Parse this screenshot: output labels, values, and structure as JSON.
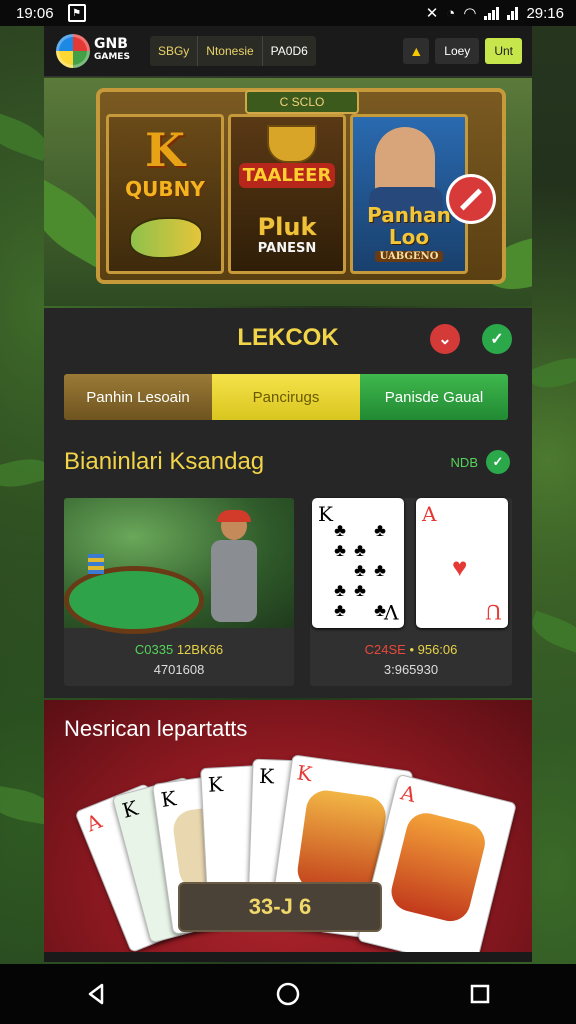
{
  "status": {
    "time": "19:06",
    "clock": "29:16"
  },
  "header": {
    "logo_line1": "GNB",
    "logo_line2": "GAMES",
    "tabs": [
      "SBGy",
      "Ntonesie",
      "PA0D6"
    ],
    "btn_dark": "Loey",
    "btn_lime": "Unt"
  },
  "banner": {
    "plaque": "C SCLO",
    "reel1_big": "K",
    "reel1_word": "QUBNY",
    "reel2_badge": "TAALEER",
    "reel2_word": "Pluk",
    "reel2_sub": "PANESN",
    "reel3_word1": "Panhan",
    "reel3_word2": "Loo",
    "reel3_badge": "UABGENO"
  },
  "panel": {
    "title": "LEKCOK",
    "segments": [
      "Panhin Lesoain",
      "Pancirugs",
      "Panisde Gaual"
    ],
    "section_title": "Bianinlari Ksandag",
    "section_badge": "NDB",
    "card_left": {
      "line1_green": "C0335",
      "line1_yellow": "12BK66",
      "line2": "4701608"
    },
    "card_right": {
      "line1_red": "C24SE",
      "line1_yellow": "956:06",
      "line2": "3:965930"
    },
    "card_right_c1_index": "K",
    "card_right_c1_index_bottom": "V",
    "card_right_c2_index": "A",
    "card_right_c2_index_bottom": "U"
  },
  "promo": {
    "title": "Nesrican lepartatts",
    "button": "33-J 6",
    "card_indices": [
      "A",
      "K",
      "K",
      "K",
      "K",
      "K",
      "A"
    ]
  },
  "colors": {
    "accent": "#f2d449",
    "green": "#2aa84a",
    "red": "#d43a37",
    "lime": "#c6e64b"
  }
}
